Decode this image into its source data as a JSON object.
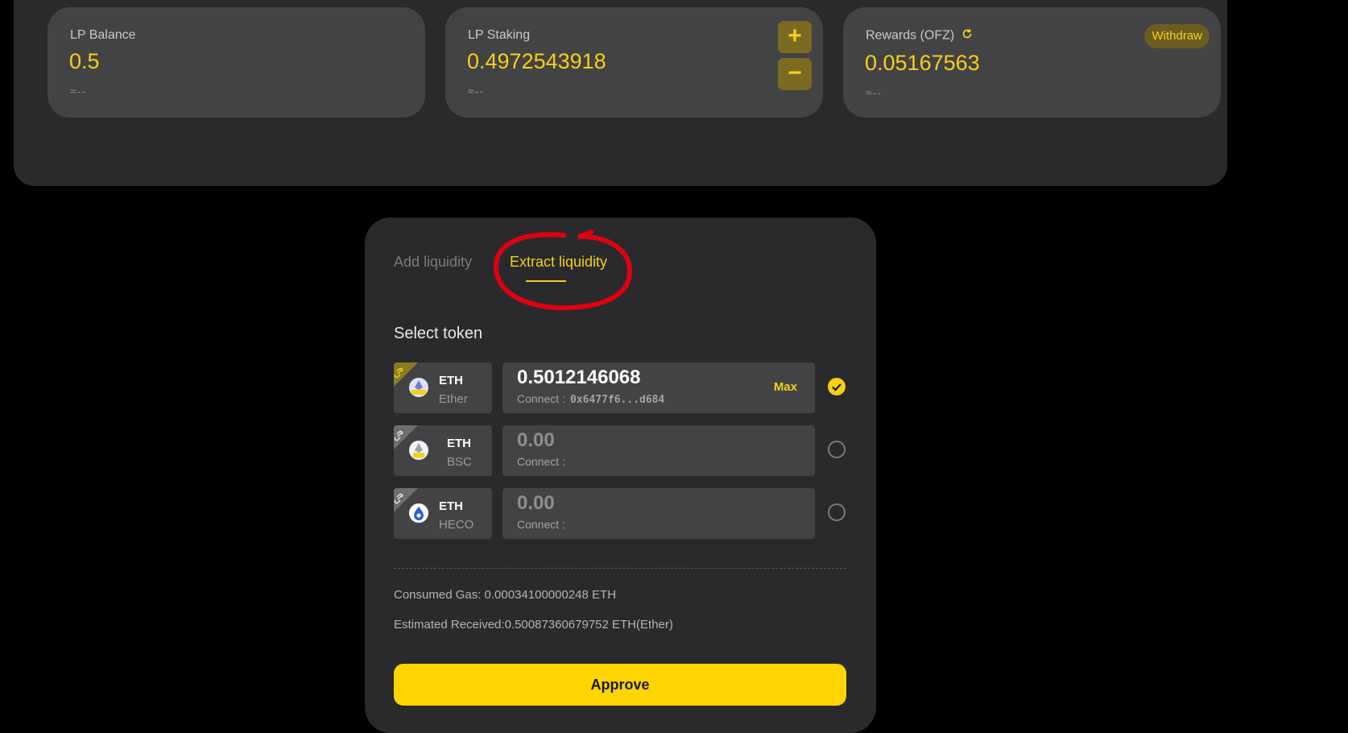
{
  "stats": {
    "lp_balance": {
      "label": "LP Balance",
      "value": "0.5",
      "approx": "≈--"
    },
    "lp_staking": {
      "label": "LP Staking",
      "value": "0.4972543918",
      "approx": "≈--",
      "plus": "+",
      "minus": "−"
    },
    "rewards": {
      "label": "Rewards (OFZ)",
      "value": "0.05167563",
      "approx": "≈--",
      "withdraw_label": "Withdraw"
    }
  },
  "tabs": {
    "add": "Add liquidity",
    "extract": "Extract liquidity",
    "active": "extract"
  },
  "select_token_title": "Select token",
  "tokens": [
    {
      "symbol": "ETH",
      "network": "Ether",
      "amount": "0.5012146068",
      "connect_label": "Connect :",
      "address": "0x6477f6...d684",
      "max_label": "Max",
      "selected": true
    },
    {
      "symbol": "ETH",
      "network": "BSC",
      "amount": "0.00",
      "connect_label": "Connect :",
      "address": "",
      "selected": false
    },
    {
      "symbol": "ETH",
      "network": "HECO",
      "amount": "0.00",
      "connect_label": "Connect :",
      "address": "",
      "selected": false
    }
  ],
  "consumed_gas": "Consumed Gas: 0.00034100000248 ETH",
  "estimated_received": "Estimated Received:0.50087360679752 ETH(Ether)",
  "approve_label": "Approve",
  "colors": {
    "accent": "#f7cf18",
    "button": "#ffd400",
    "panel": "#2a2a2c",
    "card": "#434345",
    "annotation": "#e0000f"
  }
}
